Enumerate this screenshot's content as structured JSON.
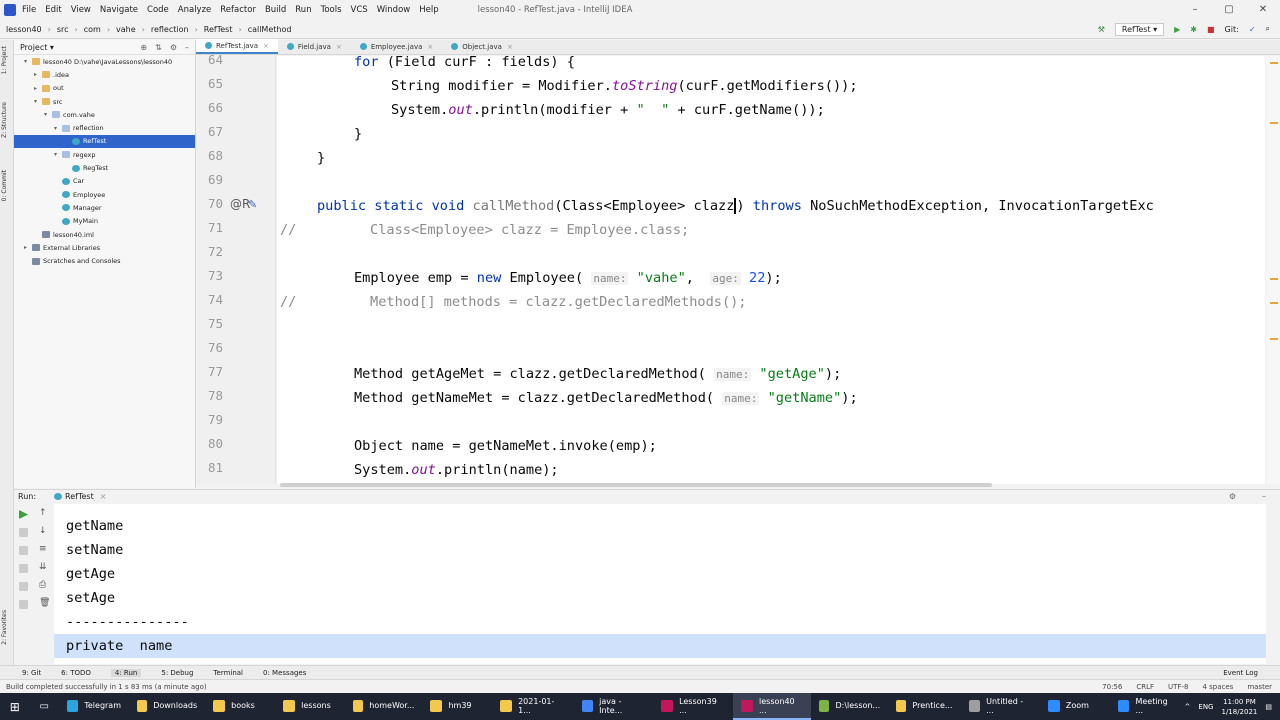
{
  "menubar": {
    "items": [
      "File",
      "Edit",
      "View",
      "Navigate",
      "Code",
      "Analyze",
      "Refactor",
      "Build",
      "Run",
      "Tools",
      "VCS",
      "Window",
      "Help"
    ],
    "window_title": "lesson40 - RefTest.java - IntelliJ IDEA",
    "controls": [
      "–",
      "▢",
      "✕"
    ]
  },
  "navbar": {
    "crumbs": [
      "lesson40",
      "src",
      "com",
      "vahe",
      "reflection",
      "RefTest",
      "callMethod"
    ],
    "run_config": "RefTest ▾",
    "git_label": "Git:"
  },
  "project": {
    "title": "Project ▾",
    "tree": [
      {
        "label": "lesson40  D:\\vahe\\JavaLessons\\lesson40",
        "indent": 1,
        "icon": "folder",
        "arrow": "▾",
        "selected": false
      },
      {
        "label": ".idea",
        "indent": 2,
        "icon": "folder",
        "arrow": "▸",
        "selected": false
      },
      {
        "label": "out",
        "indent": 2,
        "icon": "folder",
        "arrow": "▸",
        "selected": false
      },
      {
        "label": "src",
        "indent": 2,
        "icon": "folder",
        "arrow": "▾",
        "selected": false
      },
      {
        "label": "com.vahe",
        "indent": 3,
        "icon": "pkg",
        "arrow": "▾",
        "selected": false
      },
      {
        "label": "reflection",
        "indent": 4,
        "icon": "pkg",
        "arrow": "▾",
        "selected": false
      },
      {
        "label": "RefTest",
        "indent": 5,
        "icon": "cls",
        "arrow": "",
        "selected": true
      },
      {
        "label": "regexp",
        "indent": 4,
        "icon": "pkg",
        "arrow": "▾",
        "selected": false
      },
      {
        "label": "RegTest",
        "indent": 5,
        "icon": "cls",
        "arrow": "",
        "selected": false
      },
      {
        "label": "Car",
        "indent": 4,
        "icon": "cls",
        "arrow": "",
        "selected": false
      },
      {
        "label": "Employee",
        "indent": 4,
        "icon": "cls",
        "arrow": "",
        "selected": false
      },
      {
        "label": "Manager",
        "indent": 4,
        "icon": "cls",
        "arrow": "",
        "selected": false
      },
      {
        "label": "MyMain",
        "indent": 4,
        "icon": "cls",
        "arrow": "",
        "selected": false
      },
      {
        "label": "lesson40.iml",
        "indent": 2,
        "icon": "lib",
        "arrow": "",
        "selected": false
      },
      {
        "label": "External Libraries",
        "indent": 1,
        "icon": "lib",
        "arrow": "▸",
        "selected": false
      },
      {
        "label": "Scratches and Consoles",
        "indent": 1,
        "icon": "lib",
        "arrow": "",
        "selected": false
      }
    ]
  },
  "editor": {
    "tabs": [
      {
        "label": "RefTest.java",
        "active": true
      },
      {
        "label": "Field.java",
        "active": false
      },
      {
        "label": "Employee.java",
        "active": false
      },
      {
        "label": "Object.java",
        "active": false
      }
    ],
    "line_numbers": [
      "64",
      "65",
      "66",
      "67",
      "68",
      "69",
      "70",
      "71",
      "72",
      "73",
      "74",
      "75",
      "76",
      "77",
      "78",
      "79",
      "80",
      "81"
    ],
    "annotation_70": "@R"
  },
  "run": {
    "title": "Run:",
    "config": "RefTest",
    "output": [
      "getName",
      "setName",
      "getAge",
      "setAge",
      "---------------",
      "private  name"
    ]
  },
  "bottom_tabs": [
    "9: Git",
    "6: TODO",
    "4: Run",
    "5: Debug",
    "Terminal",
    "0: Messages",
    "Event Log"
  ],
  "status": {
    "message": "Build completed successfully in 1 s 83 ms (a minute ago)",
    "position": "70:56",
    "line_sep": "CRLF",
    "encoding": "UTF-8",
    "indent": "4 spaces",
    "branch": "master"
  },
  "taskbar": {
    "items": [
      {
        "label": "Telegram",
        "color": "#2aa3df",
        "active": false
      },
      {
        "label": "Downloads",
        "color": "#f2c94c",
        "active": false
      },
      {
        "label": "books",
        "color": "#f2c94c",
        "active": false
      },
      {
        "label": "lessons",
        "color": "#f2c94c",
        "active": false
      },
      {
        "label": "homeWor...",
        "color": "#f2c94c",
        "active": false
      },
      {
        "label": "hm39",
        "color": "#f2c94c",
        "active": false
      },
      {
        "label": "2021-01-1...",
        "color": "#f2c94c",
        "active": false
      },
      {
        "label": "java - Inte...",
        "color": "#4285f4",
        "active": false
      },
      {
        "label": "Lesson39 ...",
        "color": "#c2185b",
        "active": false
      },
      {
        "label": "lesson40 ...",
        "color": "#c2185b",
        "active": true
      },
      {
        "label": "D:\\lesson...",
        "color": "#7cb342",
        "active": false
      },
      {
        "label": "Prentice...",
        "color": "#f2c94c",
        "active": false
      },
      {
        "label": "Untitled - ...",
        "color": "#9e9e9e",
        "active": false
      },
      {
        "label": "Zoom",
        "color": "#2d8cff",
        "active": false
      },
      {
        "label": "Meeting ...",
        "color": "#2d8cff",
        "active": false
      }
    ],
    "time": "11:00 PM",
    "date": "1/18/2021",
    "lang": "ENG"
  },
  "colors": {
    "accent": "#2f65ca",
    "keyword": "#0033b3",
    "string": "#067d17",
    "number": "#1750eb",
    "comment": "#8c8c8c"
  }
}
